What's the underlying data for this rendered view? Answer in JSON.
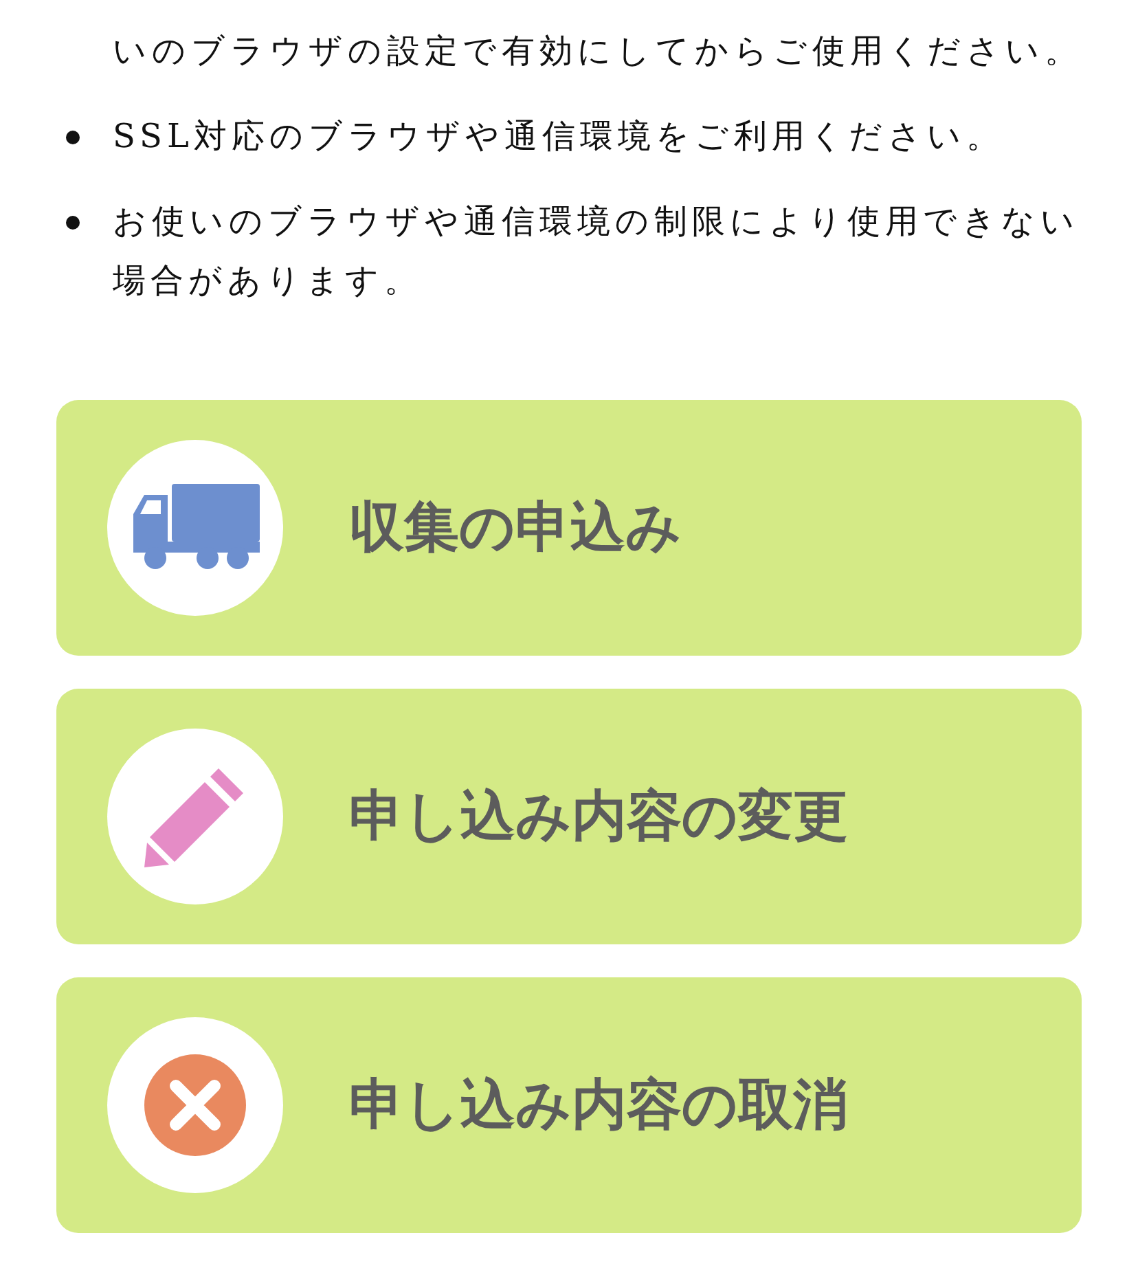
{
  "notes": [
    {
      "kind": "continuation",
      "text": "いのブラウザの設定で有効にしてからご使用ください。"
    },
    {
      "kind": "item",
      "text": "SSL対応のブラウザや通信環境をご利用ください。"
    },
    {
      "kind": "item",
      "text": "お使いのブラウザや通信環境の制限により使用できない場合があります。"
    }
  ],
  "menu_buttons": [
    {
      "label": "収集の申込み",
      "kind": "truck"
    },
    {
      "label": "申し込み内容の変更",
      "kind": "pencil"
    },
    {
      "label": "申し込み内容の取消",
      "kind": "cancel"
    }
  ]
}
